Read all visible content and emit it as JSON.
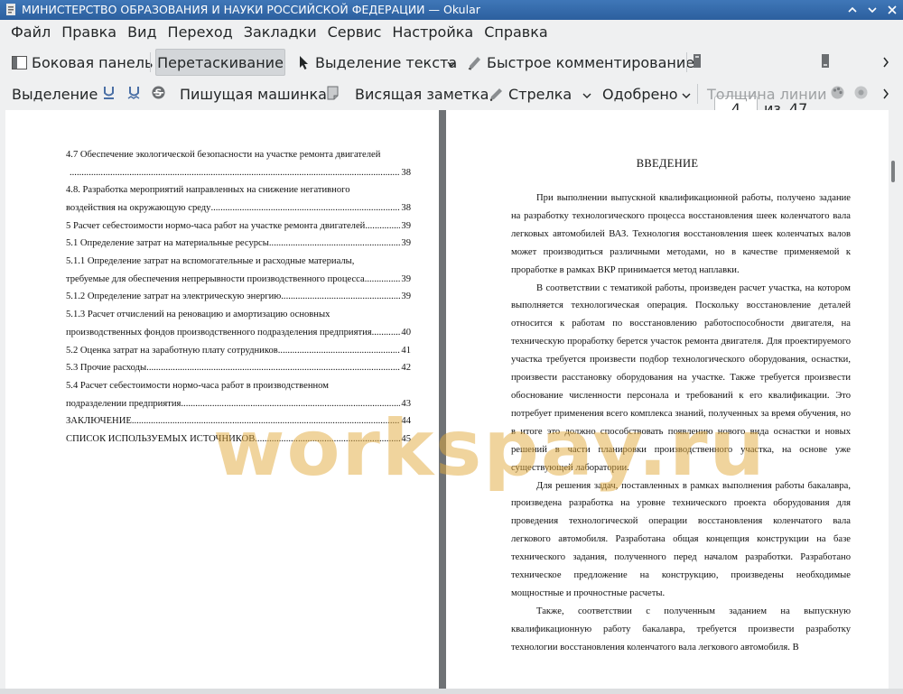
{
  "window": {
    "title": "МИНИСТЕРСТВО ОБРАЗОВАНИЯ И НАУКИ РОССИЙСКОЙ ФЕДЕРАЦИИ  — Okular"
  },
  "menu": [
    "Файл",
    "Правка",
    "Вид",
    "Переход",
    "Закладки",
    "Сервис",
    "Настройка",
    "Справка"
  ],
  "toolbar1": {
    "sidebar": "Боковая панель",
    "drag": "Перетаскивание",
    "text_select": "Выделение текста",
    "quick_comment": "Быстрое комментирование",
    "page_current": "4",
    "page_of": "из",
    "page_total": "47"
  },
  "toolbar2": {
    "selection": "Выделение",
    "typewriter": "Пишущая машинка",
    "note": "Висящая заметка",
    "arrow": "Стрелка",
    "stamp": "Одобрено",
    "line_width": "Толщина линии"
  },
  "toc": [
    {
      "text": "4.7 Обеспечение экологической безопасности на участке ремонта двигателей",
      "page": ""
    },
    {
      "text": "",
      "page": "38"
    },
    {
      "text": "4.8. Разработка мероприятий направленных на снижение негативного",
      "page": ""
    },
    {
      "text": "воздействия на окружающую среду",
      "page": "38"
    },
    {
      "text": "5 Расчет себестоимости нормо-часа работ на участке ремонта двигателей",
      "page": "39"
    },
    {
      "text": "5.1 Определение затрат на материальные ресурсы",
      "page": "39"
    },
    {
      "text": "5.1.1 Определение затрат на вспомогательные и расходные материалы,",
      "page": ""
    },
    {
      "text": "требуемые для обеспечения непрерывности производственного процесса",
      "page": "39"
    },
    {
      "text": "5.1.2 Определение затрат на электрическую энергию",
      "page": "39"
    },
    {
      "text": "5.1.3 Расчет отчислений на реновацию и амортизацию основных",
      "page": ""
    },
    {
      "text": "производственных фондов производственного подразделения предприятия",
      "page": "40"
    },
    {
      "text": "5.2 Оценка затрат на заработную плату сотрудников",
      "page": "41"
    },
    {
      "text": "5.3 Прочие расходы",
      "page": "42"
    },
    {
      "text": "5.4 Расчет себестоимости нормо-часа работ в производственном",
      "page": ""
    },
    {
      "text": "подразделении предприятия",
      "page": "43"
    },
    {
      "text": "ЗАКЛЮЧЕНИЕ",
      "page": "44"
    },
    {
      "text": "СПИСОК ИСПОЛЬЗУЕМЫХ ИСТОЧНИКОВ",
      "page": "45"
    }
  ],
  "right_page": {
    "heading": "ВВЕДЕНИЕ",
    "paragraphs": [
      "При выполнении выпускной квалификационной работы, получено задание на разработку технологического процесса восстановления шеек коленчатого вала легковых автомобилей ВАЗ. Технология восстановления шеек коленчатых валов может производиться различными методами, но в качестве применяемой к проработке в рамках ВКР принимается метод наплавки.",
      "В соответствии с тематикой работы, произведен расчет участка, на котором выполняется технологическая операция. Поскольку восстановление деталей относится к работам по восстановлению работоспособности двигателя, на техническую проработку берется участок ремонта двигателя. Для проектируемого участка требуется произвести подбор технологического оборудования, оснастки, произвести расстановку оборудования на участке. Также требуется произвести обоснование численности персонала и требований к его квалификации. Это потребует применения всего комплекса знаний, полученных за время обучения, но в итоге это должно способствовать появлению нового вида оснастки и новых решений в части планировки производственного участка, на основе уже существующей лаборатории.",
      "Для решения задач, поставленных в рамках выполнения работы бакалавра, произведена разработка на уровне технического проекта оборудования для проведения технологической операции восстановления коленчатого вала легкового автомобиля. Разработана общая концепция конструкции на базе технического задания, полученного перед началом разработки. Разработано техническое предложение на конструкцию, произведены необходимые мощностные и прочностные расчеты.",
      "Также, соответствии с полученным заданием на выпускную квалификационную работу бакалавра, требуется произвести разработку технологии восстановления коленчатого вала легкового автомобиля. В"
    ]
  },
  "watermark": "workspay.ru"
}
